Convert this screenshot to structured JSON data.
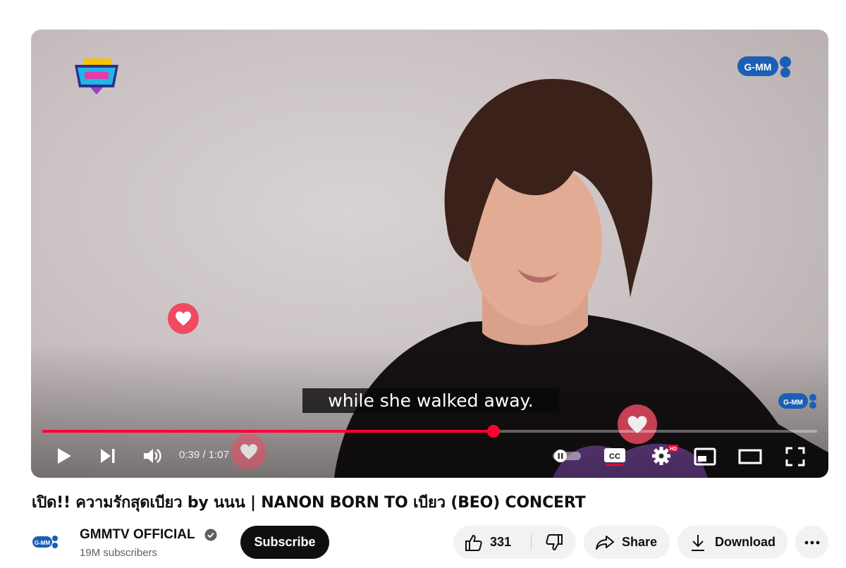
{
  "player": {
    "subtitle": "while she walked away.",
    "current_time": "0:39",
    "separator": " / ",
    "duration": "1:07",
    "progress_fraction": 0.5822,
    "brand_logo_text": "G-MM",
    "hd_badge": "HD"
  },
  "video": {
    "title": "เปิด!! ความรักสุดเบียว by นนน | NANON BORN TO เบียว (BEO) CONCERT"
  },
  "channel": {
    "name": "GMMTV OFFICIAL",
    "subscribers": "19M subscribers",
    "subscribe_label": "Subscribe"
  },
  "actions": {
    "like_count": "331",
    "share_label": "Share",
    "download_label": "Download"
  },
  "colors": {
    "progress": "#ff0033",
    "heart": "#ef4a62",
    "brand_blue": "#1b5fb5"
  }
}
